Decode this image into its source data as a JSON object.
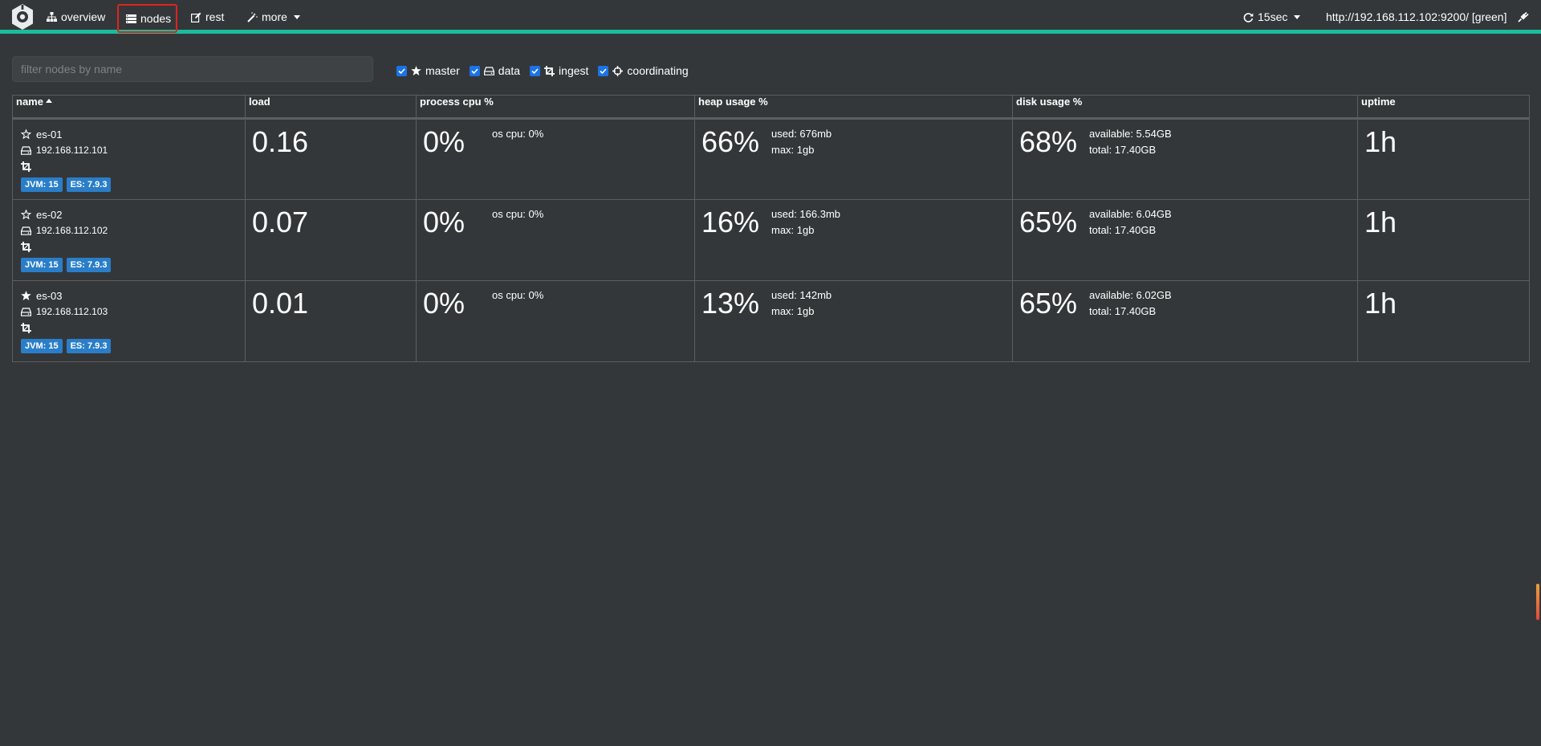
{
  "navbar": {
    "items": [
      {
        "label": "overview",
        "icon": "sitemap-icon"
      },
      {
        "label": "nodes",
        "icon": "server-icon"
      },
      {
        "label": "rest",
        "icon": "edit-icon"
      },
      {
        "label": "more",
        "icon": "wand-icon"
      }
    ],
    "refresh_label": "15sec",
    "cluster_url": "http://192.168.112.102:9200/ [green]",
    "status_color": "#1abc9c"
  },
  "filter": {
    "placeholder": "filter nodes by name",
    "value": ""
  },
  "roles": [
    {
      "label": "master",
      "checked": true,
      "icon": "star-icon"
    },
    {
      "label": "data",
      "checked": true,
      "icon": "hdd-icon"
    },
    {
      "label": "ingest",
      "checked": true,
      "icon": "crop-icon"
    },
    {
      "label": "coordinating",
      "checked": true,
      "icon": "crosshairs-icon"
    }
  ],
  "table": {
    "headers": {
      "name": "name",
      "load": "load",
      "cpu": "process cpu %",
      "heap": "heap usage %",
      "disk": "disk usage %",
      "uptime": "uptime"
    },
    "rows": [
      {
        "name": "es-01",
        "master_icon": "star-outline-icon",
        "ip": "192.168.112.101",
        "jvm": "JVM: 15",
        "es": "ES: 7.9.3",
        "load": "0.16",
        "cpu": "0%",
        "os_cpu": "os cpu: 0%",
        "heap": "66%",
        "heap_used": "used: 676mb",
        "heap_max": "max: 1gb",
        "disk": "68%",
        "disk_available": "available: 5.54GB",
        "disk_total": "total: 17.40GB",
        "uptime": "1h"
      },
      {
        "name": "es-02",
        "master_icon": "star-outline-icon",
        "ip": "192.168.112.102",
        "jvm": "JVM: 15",
        "es": "ES: 7.9.3",
        "load": "0.07",
        "cpu": "0%",
        "os_cpu": "os cpu: 0%",
        "heap": "16%",
        "heap_used": "used: 166.3mb",
        "heap_max": "max: 1gb",
        "disk": "65%",
        "disk_available": "available: 6.04GB",
        "disk_total": "total: 17.40GB",
        "uptime": "1h"
      },
      {
        "name": "es-03",
        "master_icon": "star-filled-icon",
        "ip": "192.168.112.103",
        "jvm": "JVM: 15",
        "es": "ES: 7.9.3",
        "load": "0.01",
        "cpu": "0%",
        "os_cpu": "os cpu: 0%",
        "heap": "13%",
        "heap_used": "used: 142mb",
        "heap_max": "max: 1gb",
        "disk": "65%",
        "disk_available": "available: 6.02GB",
        "disk_total": "total: 17.40GB",
        "uptime": "1h"
      }
    ]
  }
}
